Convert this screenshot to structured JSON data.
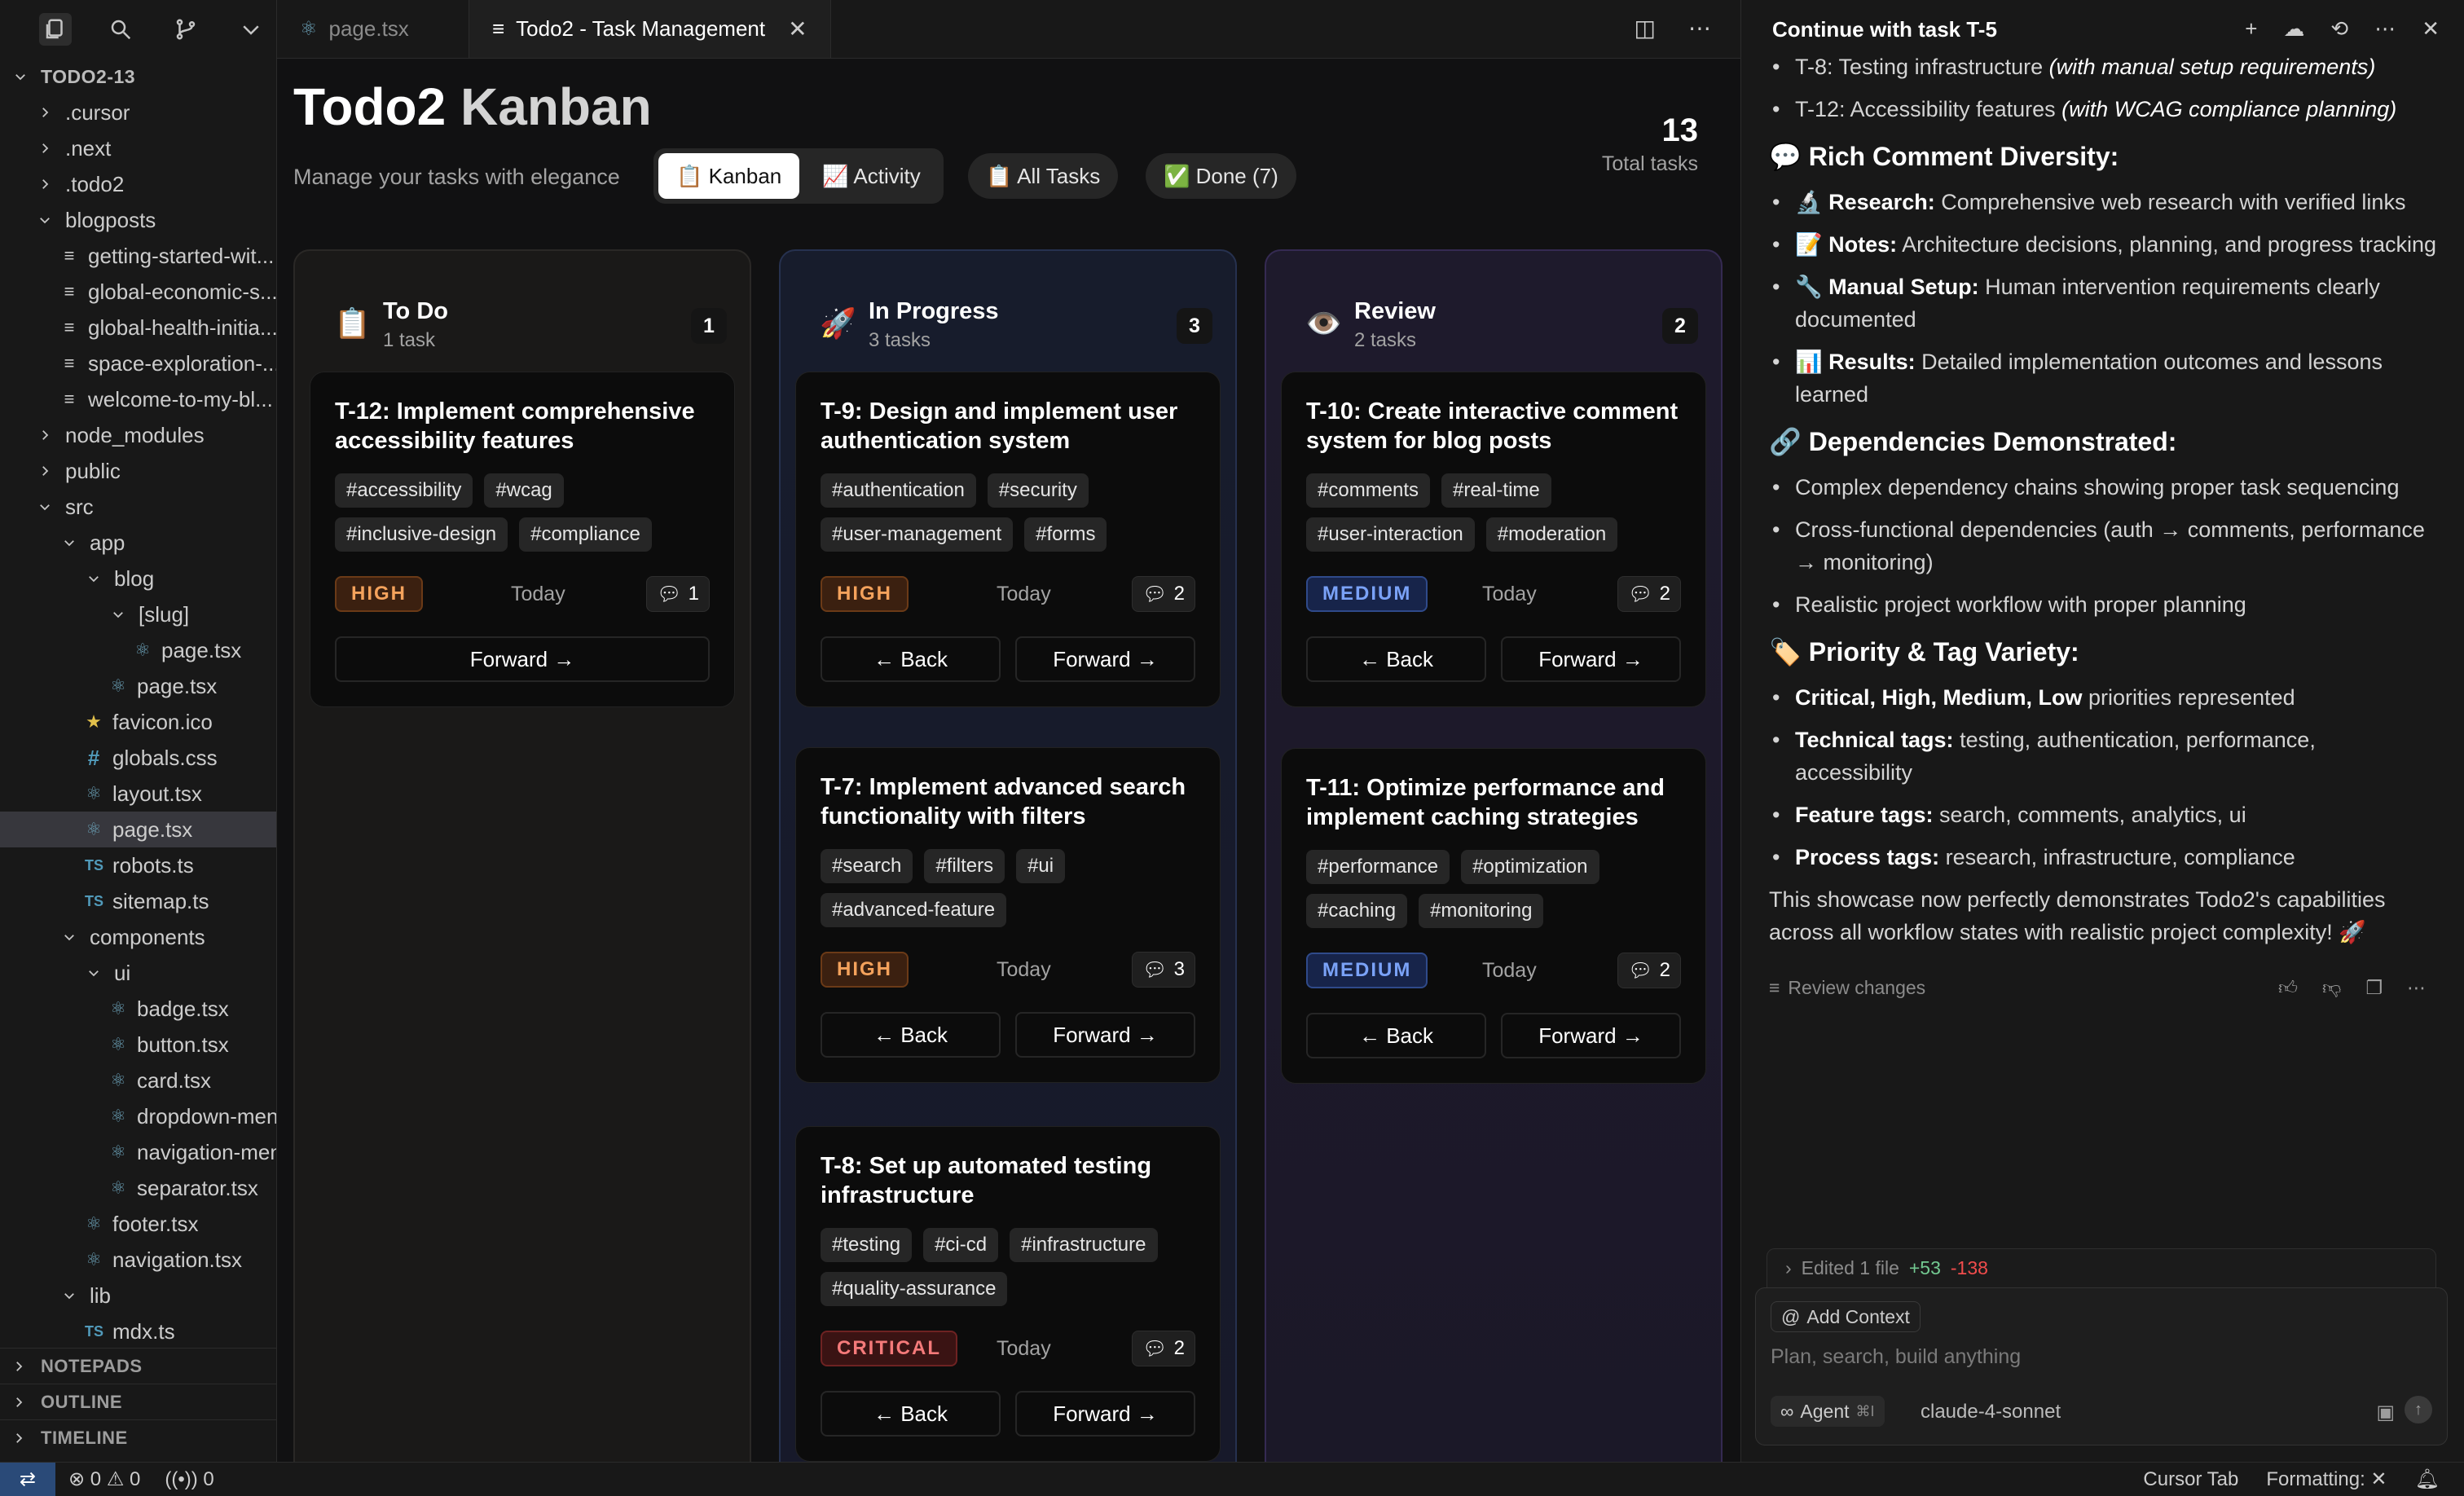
{
  "sidebar": {
    "root": "TODO2-13",
    "tree": [
      {
        "label": ".cursor",
        "depth": 1,
        "kind": "folder",
        "open": false
      },
      {
        "label": ".next",
        "depth": 1,
        "kind": "folder",
        "open": false
      },
      {
        "label": ".todo2",
        "depth": 1,
        "kind": "folder",
        "open": false
      },
      {
        "label": "blogposts",
        "depth": 1,
        "kind": "folder",
        "open": true
      },
      {
        "label": "getting-started-wit...",
        "depth": 2,
        "kind": "md"
      },
      {
        "label": "global-economic-s...",
        "depth": 2,
        "kind": "md"
      },
      {
        "label": "global-health-initia...",
        "depth": 2,
        "kind": "md"
      },
      {
        "label": "space-exploration-...",
        "depth": 2,
        "kind": "md"
      },
      {
        "label": "welcome-to-my-bl...",
        "depth": 2,
        "kind": "md"
      },
      {
        "label": "node_modules",
        "depth": 1,
        "kind": "folder",
        "open": false
      },
      {
        "label": "public",
        "depth": 1,
        "kind": "folder",
        "open": false
      },
      {
        "label": "src",
        "depth": 1,
        "kind": "folder",
        "open": true
      },
      {
        "label": "app",
        "depth": 2,
        "kind": "folder",
        "open": true
      },
      {
        "label": "blog",
        "depth": 3,
        "kind": "folder",
        "open": true
      },
      {
        "label": "[slug]",
        "depth": 4,
        "kind": "folder",
        "open": true
      },
      {
        "label": "page.tsx",
        "depth": 5,
        "kind": "react"
      },
      {
        "label": "page.tsx",
        "depth": 4,
        "kind": "react"
      },
      {
        "label": "favicon.ico",
        "depth": 3,
        "kind": "star"
      },
      {
        "label": "globals.css",
        "depth": 3,
        "kind": "css"
      },
      {
        "label": "layout.tsx",
        "depth": 3,
        "kind": "react"
      },
      {
        "label": "page.tsx",
        "depth": 3,
        "kind": "react",
        "active": true
      },
      {
        "label": "robots.ts",
        "depth": 3,
        "kind": "ts"
      },
      {
        "label": "sitemap.ts",
        "depth": 3,
        "kind": "ts"
      },
      {
        "label": "components",
        "depth": 2,
        "kind": "folder",
        "open": true
      },
      {
        "label": "ui",
        "depth": 3,
        "kind": "folder",
        "open": true
      },
      {
        "label": "badge.tsx",
        "depth": 4,
        "kind": "react"
      },
      {
        "label": "button.tsx",
        "depth": 4,
        "kind": "react"
      },
      {
        "label": "card.tsx",
        "depth": 4,
        "kind": "react"
      },
      {
        "label": "dropdown-menu...",
        "depth": 4,
        "kind": "react"
      },
      {
        "label": "navigation-men...",
        "depth": 4,
        "kind": "react"
      },
      {
        "label": "separator.tsx",
        "depth": 4,
        "kind": "react"
      },
      {
        "label": "footer.tsx",
        "depth": 3,
        "kind": "react"
      },
      {
        "label": "navigation.tsx",
        "depth": 3,
        "kind": "react"
      },
      {
        "label": "lib",
        "depth": 2,
        "kind": "folder",
        "open": true
      },
      {
        "label": "mdx.ts",
        "depth": 3,
        "kind": "ts"
      }
    ],
    "sections": [
      "NOTEPADS",
      "OUTLINE",
      "TIMELINE"
    ]
  },
  "editor": {
    "tabs": [
      {
        "label": "page.tsx",
        "active": false
      },
      {
        "label": "Todo2 - Task Management",
        "active": true
      }
    ]
  },
  "kanban": {
    "title_main": "Todo2",
    "title_accent": "Kanban",
    "subtitle": "Manage your tasks with elegance",
    "view_kanban": "📋 Kanban",
    "view_activity": "📈 Activity",
    "filter_all": "📋 All Tasks",
    "filter_done": "✅ Done (7)",
    "total_count": "13",
    "total_label": "Total tasks",
    "back_label": "← Back",
    "forward_label": "Forward →",
    "date_label": "Today",
    "columns": [
      {
        "name": "To Do",
        "emoji": "📋",
        "count_label": "1 task",
        "badge": "1",
        "cards": [
          {
            "id": "T-12:",
            "title": "Implement comprehensive accessibility features",
            "tags": [
              "#accessibility",
              "#wcag",
              "#inclusive-design",
              "#compliance"
            ],
            "priority": "HIGH",
            "comments": "1",
            "back": false
          }
        ]
      },
      {
        "name": "In Progress",
        "emoji": "🚀",
        "count_label": "3 tasks",
        "badge": "3",
        "cards": [
          {
            "id": "T-9:",
            "title": "Design and implement user authentication system",
            "tags": [
              "#authentication",
              "#security",
              "#user-management",
              "#forms"
            ],
            "priority": "HIGH",
            "comments": "2",
            "back": true
          },
          {
            "id": "T-7:",
            "title": "Implement advanced search functionality with filters",
            "tags": [
              "#search",
              "#filters",
              "#ui",
              "#advanced-feature"
            ],
            "priority": "HIGH",
            "comments": "3",
            "back": true
          },
          {
            "id": "T-8:",
            "title": "Set up automated testing infrastructure",
            "tags": [
              "#testing",
              "#ci-cd",
              "#infrastructure",
              "#quality-assurance"
            ],
            "priority": "CRITICAL",
            "comments": "2",
            "back": true
          }
        ]
      },
      {
        "name": "Review",
        "emoji": "👁️",
        "count_label": "2 tasks",
        "badge": "2",
        "cards": [
          {
            "id": "T-10:",
            "title": "Create interactive comment system for blog posts",
            "tags": [
              "#comments",
              "#real-time",
              "#user-interaction",
              "#moderation"
            ],
            "priority": "MEDIUM",
            "comments": "2",
            "back": true
          },
          {
            "id": "T-11:",
            "title": "Optimize performance and implement caching strategies",
            "tags": [
              "#performance",
              "#optimization",
              "#caching",
              "#monitoring"
            ],
            "priority": "MEDIUM",
            "comments": "2",
            "back": true
          }
        ]
      }
    ]
  },
  "chat": {
    "header_title": "Continue with task T-5",
    "top_items": [
      {
        "text": "T-8: Testing infrastructure ",
        "em": "(with manual setup requirements)"
      },
      {
        "text": "T-12: Accessibility features ",
        "em": "(with WCAG compliance planning)"
      }
    ],
    "h_comments": "💬 Rich Comment Diversity:",
    "comment_items": [
      {
        "bold": "🔬 Research:",
        "text": " Comprehensive web research with verified links"
      },
      {
        "bold": "📝 Notes:",
        "text": " Architecture decisions, planning, and progress tracking"
      },
      {
        "bold": "🔧 Manual Setup:",
        "text": " Human intervention requirements clearly documented"
      },
      {
        "bold": "📊 Results:",
        "text": " Detailed implementation outcomes and lessons learned"
      }
    ],
    "h_deps": "🔗 Dependencies Demonstrated:",
    "dep_items": [
      "Complex dependency chains showing proper task sequencing",
      "Cross-functional dependencies (auth → comments, performance → monitoring)",
      "Realistic project workflow with proper planning"
    ],
    "h_priority": "🏷️ Priority & Tag Variety:",
    "priority_items": [
      {
        "bold": "Critical, High, Medium, Low",
        "text": " priorities represented"
      },
      {
        "bold": "Technical tags:",
        "text": " testing, authentication, performance, accessibility"
      },
      {
        "bold": "Feature tags:",
        "text": " search, comments, analytics, ui"
      },
      {
        "bold": "Process tags:",
        "text": " research, infrastructure, compliance"
      }
    ],
    "closing": "This showcase now perfectly demonstrates Todo2's capabilities across all workflow states with realistic project complexity! 🚀",
    "review_changes": "Review changes",
    "edited_prefix": "Edited 1 file",
    "edited_plus": "+53",
    "edited_minus": "-138",
    "add_context": "Add Context",
    "placeholder": "Plan, search, build anything",
    "agent_label": "Agent",
    "agent_kbd": "⌘I",
    "model": "claude-4-sonnet"
  },
  "statusbar": {
    "errors": "0",
    "warnings": "0",
    "ports": "0",
    "cursor_tab": "Cursor Tab",
    "formatting": "Formatting:"
  }
}
